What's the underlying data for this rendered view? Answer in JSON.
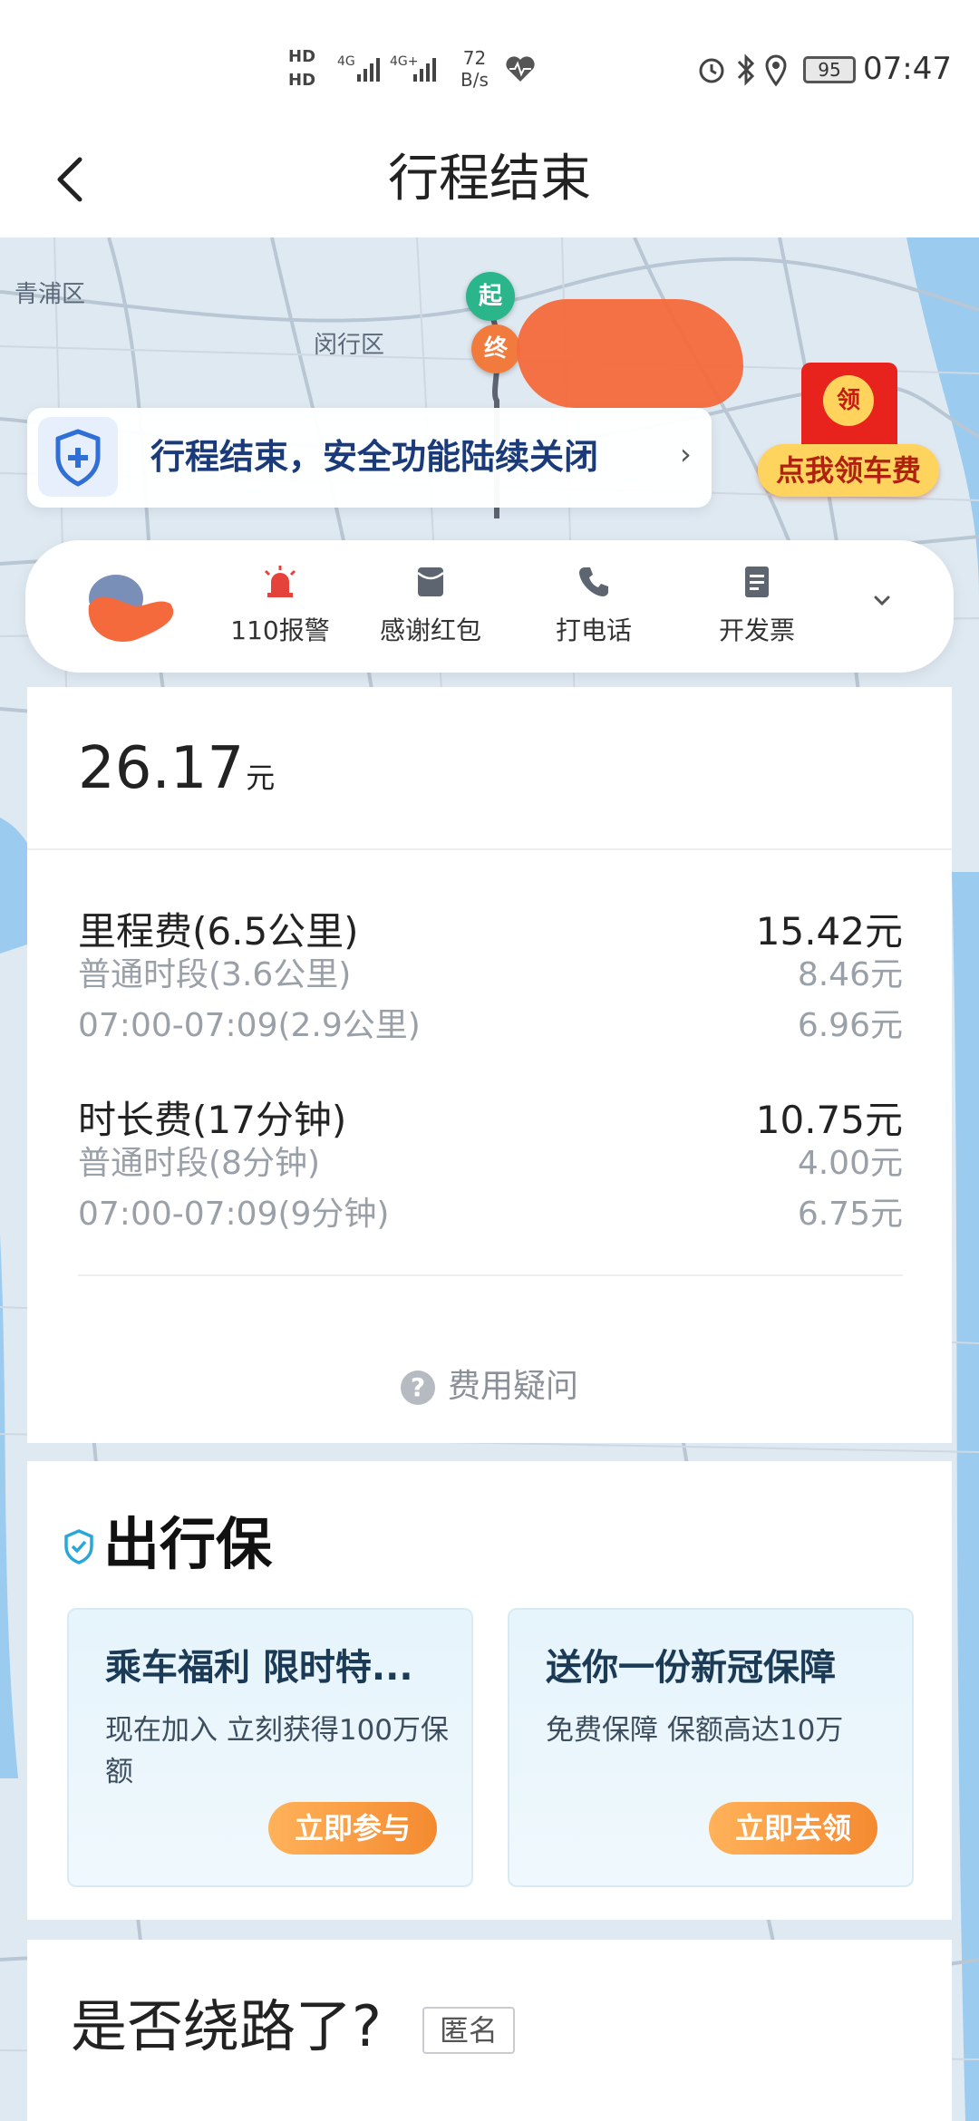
{
  "status_bar": {
    "hd1": "HD",
    "hd2": "HD",
    "net1": "4G",
    "net2": "4G+",
    "speed_value": "72",
    "speed_unit": "B/s",
    "battery": "95",
    "time": "07:47"
  },
  "header": {
    "title": "行程结束"
  },
  "map": {
    "labels": [
      "青浦区",
      "闵行区"
    ],
    "start_marker": "起",
    "end_marker": "终"
  },
  "safety_banner": {
    "text": "行程结束，安全功能陆续关闭"
  },
  "red_packet": {
    "seal": "领",
    "label": "点我领车费"
  },
  "actions": [
    {
      "label": "110报警",
      "icon": "alarm-light-icon"
    },
    {
      "label": "感谢红包",
      "icon": "red-envelope-icon"
    },
    {
      "label": "打电话",
      "icon": "phone-icon"
    },
    {
      "label": "开发票",
      "icon": "invoice-icon"
    }
  ],
  "fare": {
    "total": "26.17",
    "total_unit": "元",
    "mileage": {
      "label": "里程费(6.5公里)",
      "amount": "15.42元",
      "items": [
        {
          "label": "普通时段(3.6公里)",
          "amount": "8.46元"
        },
        {
          "label": "07:00-07:09(2.9公里)",
          "amount": "6.96元"
        }
      ]
    },
    "duration": {
      "label": "时长费(17分钟)",
      "amount": "10.75元",
      "items": [
        {
          "label": "普通时段(8分钟)",
          "amount": "4.00元"
        },
        {
          "label": "07:00-07:09(9分钟)",
          "amount": "6.75元"
        }
      ]
    },
    "question": "费用疑问"
  },
  "insurance": {
    "title": "出行保",
    "cards": [
      {
        "title": "乘车福利 限时特...",
        "desc": "现在加入 立刻获得100万保额",
        "button": "立即参与"
      },
      {
        "title": "送你一份新冠保障",
        "desc": "免费保障 保额高达10万",
        "button": "立即去领"
      }
    ]
  },
  "detour": {
    "question": "是否绕路了?",
    "tag": "匿名"
  },
  "colors": {
    "brand_blue": "#1a3a7a",
    "accent_orange": "#f48a30",
    "start_green": "#2bb58a",
    "end_orange": "#f07b3d",
    "red_packet": "#e8231e"
  }
}
